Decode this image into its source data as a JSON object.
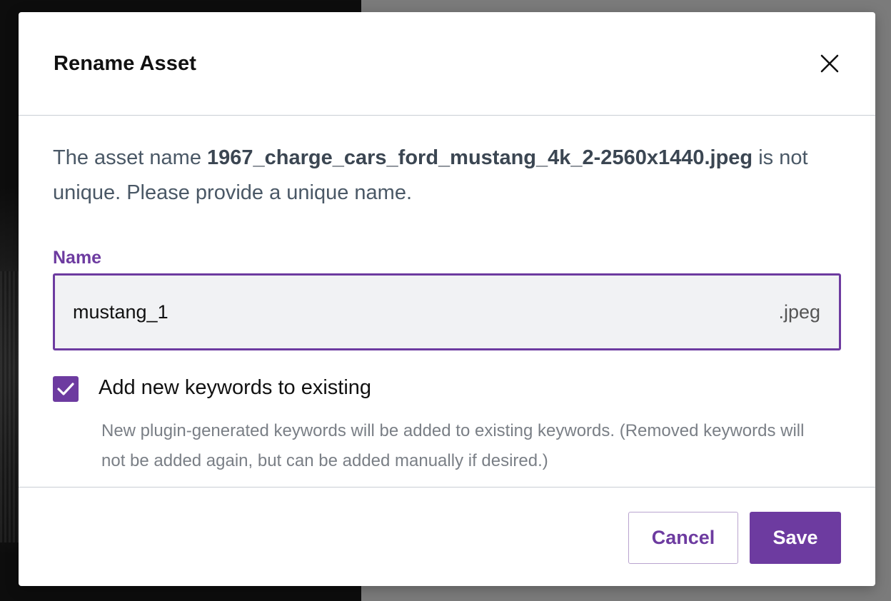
{
  "dialog": {
    "title": "Rename Asset",
    "message_prefix": "The asset name ",
    "asset_name": "1967_charge_cars_ford_mustang_4k_2-2560x1440.jpeg",
    "message_suffix": " is not unique. Please provide a unique name.",
    "name_label": "Name",
    "name_value": "mustang_1",
    "extension": ".jpeg",
    "keywords_checkbox": {
      "checked": true,
      "label": "Add new keywords to existing",
      "help": "New plugin-generated keywords will be added to existing keywords. (Removed keywords will not be added again, but can be added manually if desired.)"
    },
    "cancel_label": "Cancel",
    "save_label": "Save"
  },
  "icons": {
    "close": "close-icon",
    "check": "checkmark-icon"
  },
  "colors": {
    "accent": "#6d3ba0",
    "text_muted": "#4a5866",
    "help_text": "#7a7f86",
    "overlay": "#7b7b7b"
  }
}
